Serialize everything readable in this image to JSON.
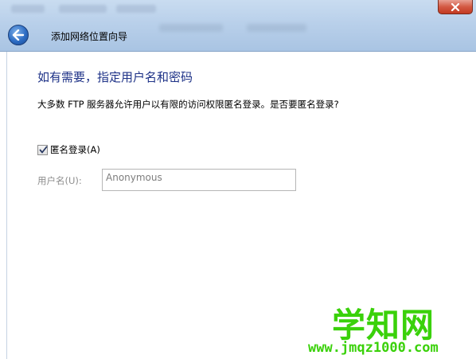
{
  "window": {
    "close_icon": "close-icon"
  },
  "header": {
    "back_icon": "back-arrow-icon",
    "title": "添加网络位置向导"
  },
  "main": {
    "heading": "如有需要，指定用户名和密码",
    "description": "大多数 FTP 服务器允许用户以有限的访问权限匿名登录。是否要匿名登录?",
    "anonymous_checkbox": {
      "label": "匿名登录(A)",
      "checked": true
    },
    "username": {
      "label": "用户名(U):",
      "value": "Anonymous"
    }
  },
  "watermark": {
    "main": "学知网",
    "url": "www.jmqz1000.com"
  },
  "colors": {
    "heading": "#1e3287",
    "close_button": "#c23a22",
    "watermark": "#3ad10a"
  }
}
